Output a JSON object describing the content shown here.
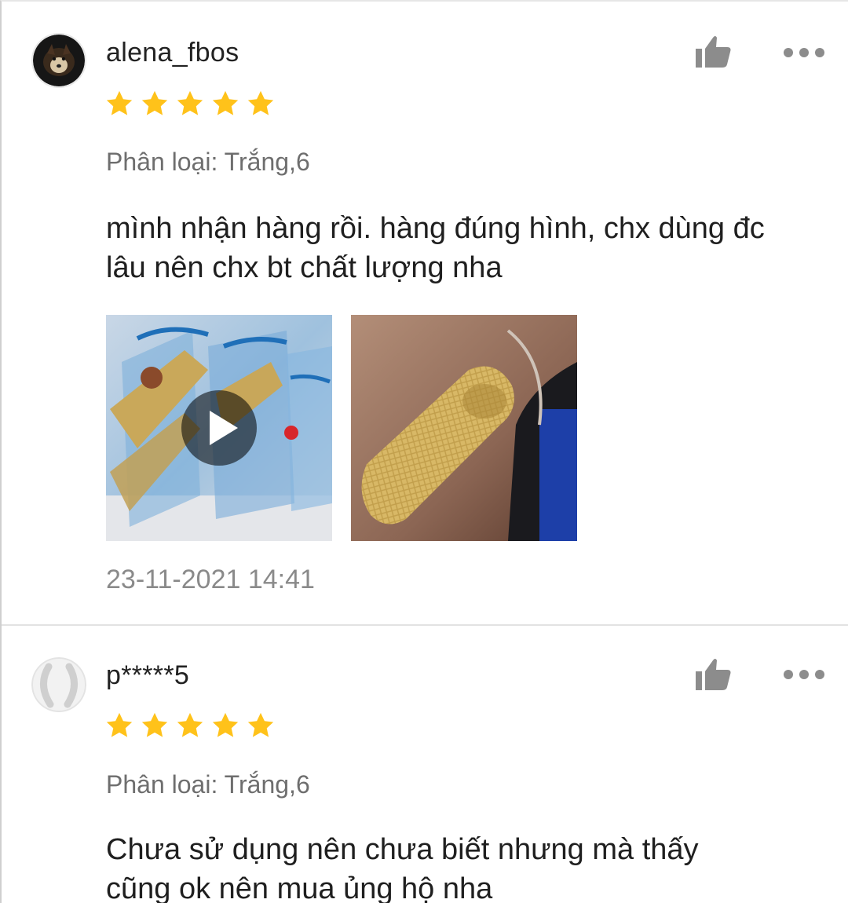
{
  "reviews": [
    {
      "username": "alena_fbos",
      "rating": 5,
      "variant": "Phân loại: Trắng,6",
      "comment_lines": [
        "mình nhận hàng rồi. hàng đúng hình, chx dùng đc",
        "lâu nên chx bt chất lượng nha"
      ],
      "media": [
        {
          "kind": "video-thumbnail",
          "icon": "play-icon"
        },
        {
          "kind": "photo"
        }
      ],
      "date": "23-11-2021 14:41"
    },
    {
      "username": "p*****5",
      "rating": 5,
      "variant": "Phân loại: Trắng,6",
      "comment_lines": [
        "Chưa sử dụng nên chưa biết nhưng mà thấy",
        "cũng ok nên mua ủng hộ nha"
      ]
    }
  ],
  "icons": {
    "like": "thumbs-up-icon",
    "more": "more-dots-icon",
    "star": "star-icon"
  },
  "colors": {
    "star": "#FFC21A",
    "icon_gray": "#8c8c8c",
    "divider": "#e2e2e2"
  }
}
